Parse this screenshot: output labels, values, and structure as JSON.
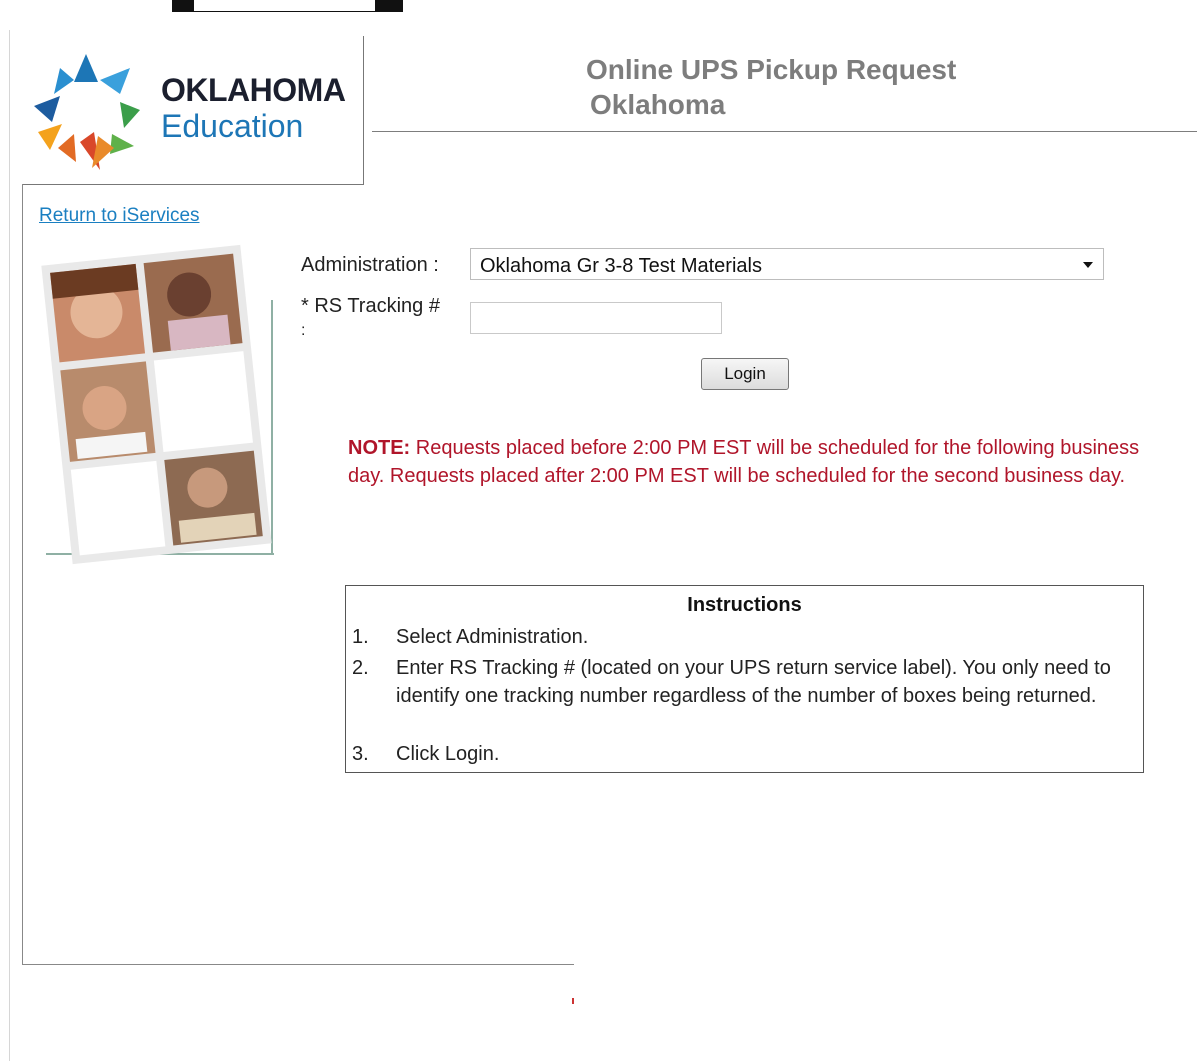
{
  "header": {
    "logo": {
      "line1": "OKLAHOMA",
      "line2": "Education"
    },
    "title": "Online UPS Pickup Request",
    "subtitle": "Oklahoma"
  },
  "nav": {
    "return_link": "Return to iServices"
  },
  "form": {
    "administration_label": "Administration :",
    "administration_value": "Oklahoma Gr 3-8 Test Materials",
    "tracking_label": "* RS Tracking #",
    "tracking_label_colon": ":",
    "tracking_value": "",
    "login_label": "Login"
  },
  "note": {
    "prefix": "NOTE:",
    "text": "Requests placed before 2:00 PM EST will be scheduled for the following business day. Requests placed after 2:00 PM EST will be scheduled for the second business day."
  },
  "instructions": {
    "title": "Instructions",
    "items": [
      {
        "num": "1.",
        "text": "Select Administration."
      },
      {
        "num": "2.",
        "text": "Enter RS Tracking # (located on your UPS return service label). You only need to identify one tracking number regardless of the number of boxes being returned."
      },
      {
        "num": "3.",
        "text": "Click Login."
      }
    ]
  },
  "colors": {
    "note_red": "#b0152a",
    "link_blue": "#1a7fc1",
    "logo_blue": "#1d76b6",
    "header_gray": "#7d7d7d"
  }
}
